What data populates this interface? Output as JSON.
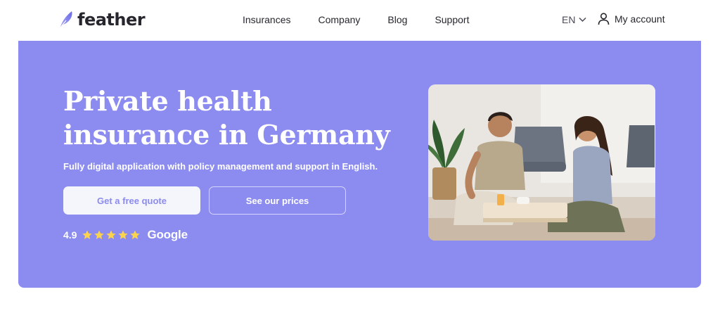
{
  "brand": {
    "name": "feather"
  },
  "nav": {
    "items": [
      {
        "label": "Insurances"
      },
      {
        "label": "Company"
      },
      {
        "label": "Blog"
      },
      {
        "label": "Support"
      }
    ],
    "language": "EN",
    "account": "My account"
  },
  "hero": {
    "title_line1": "Private health",
    "title_line2": "insurance in Germany",
    "subtitle": "Fully digital application with policy management and  support in English.",
    "primary_button": "Get a free quote",
    "secondary_button": "See our prices",
    "rating": {
      "score": "4.9",
      "stars": 5,
      "source": "Google"
    },
    "photo_icon": "people-photo"
  },
  "colors": {
    "brand_purple": "#8b8bf0",
    "text_dark": "#26262e",
    "button_light": "#f5f5fc",
    "star_yellow": "#fcd34d"
  }
}
